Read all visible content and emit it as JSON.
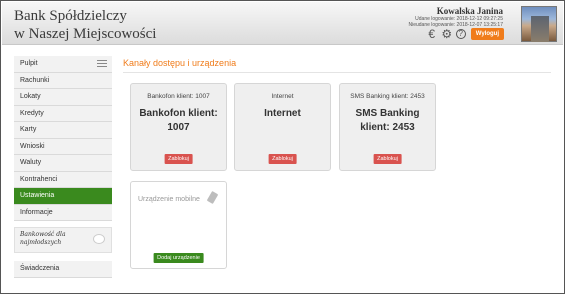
{
  "header": {
    "bank_line1": "Bank Spółdzielczy",
    "bank_line2": "w Naszej Miejscowości",
    "user_name": "Kowalska Janina",
    "last_login": "Udane logowanie: 2018-12-12 09:27:25",
    "failed_login": "Nieudane logowanie: 2018-12-07 13:25:17",
    "currency_icon": "€",
    "settings_icon": "⚙",
    "help_icon": "?",
    "logout_label": "Wyloguj"
  },
  "sidebar": {
    "items": [
      {
        "label": "Pulpit"
      },
      {
        "label": "Rachunki"
      },
      {
        "label": "Lokaty"
      },
      {
        "label": "Kredyty"
      },
      {
        "label": "Karty"
      },
      {
        "label": "Wnioski"
      },
      {
        "label": "Waluty"
      },
      {
        "label": "Kontrahenci"
      },
      {
        "label": "Ustawienia",
        "active": true
      },
      {
        "label": "Informacje"
      }
    ],
    "promo_text": "Bankowość dla najmłodszych",
    "bottom_item": "Świadczenia"
  },
  "main": {
    "title": "Kanały dostępu i urządzenia",
    "cards": [
      {
        "head": "Bankofon klient: 1007",
        "body": "Bankofon klient: 1007",
        "button": "Zablokuj"
      },
      {
        "head": "Internet",
        "body": "Internet",
        "button": "Zablokuj"
      },
      {
        "head": "SMS Banking klient: 2453",
        "body": "SMS Banking klient: 2453",
        "button": "Zablokuj"
      }
    ],
    "mobile": {
      "title": "Urządzenie mobilne",
      "button": "Dodaj urządzenie"
    }
  },
  "colors": {
    "accent": "#f07c1b",
    "active_nav": "#3a8a1e",
    "block_button": "#d9534f",
    "add_button": "#3a8a1e"
  }
}
